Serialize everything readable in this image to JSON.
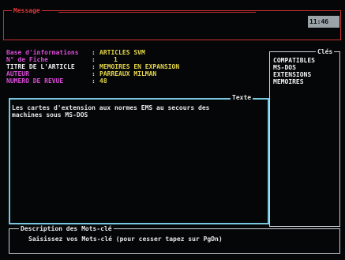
{
  "message": {
    "title": "Message",
    "time": "11:46"
  },
  "info": {
    "rows": [
      {
        "label": "Base d'informations",
        "value": "ARTICLES SVM"
      },
      {
        "label": "N° de Fiche",
        "value": "1"
      },
      {
        "label": "TITRE DE L'ARTICLE",
        "value": "MEMOIRES EN EXPANSION"
      },
      {
        "label": "AUTEUR",
        "value": "PARREAUX MILMAN"
      },
      {
        "label": "NUMERO DE REVUE",
        "value": "48"
      }
    ],
    "separator": ":"
  },
  "keys": {
    "title": "Clés",
    "items": [
      "COMPATIBLES",
      "MS-DOS",
      "EXTENSIONS",
      "MEMOIRES"
    ]
  },
  "text": {
    "title": "Texte",
    "lines": [
      "Les cartes d'extension aux normes EMS au secours des",
      "machines sous MS-DOS"
    ]
  },
  "description": {
    "title": "Description des Mots-clé",
    "prompt": "Saisissez vos Mots-clé (pour cesser tapez sur PgDn)"
  },
  "colors": {
    "label": "#d94cd6",
    "value": "#e6d84a",
    "message_frame": "#c83030",
    "text_frame": "#77c7de",
    "frame": "#c9d2d6"
  }
}
